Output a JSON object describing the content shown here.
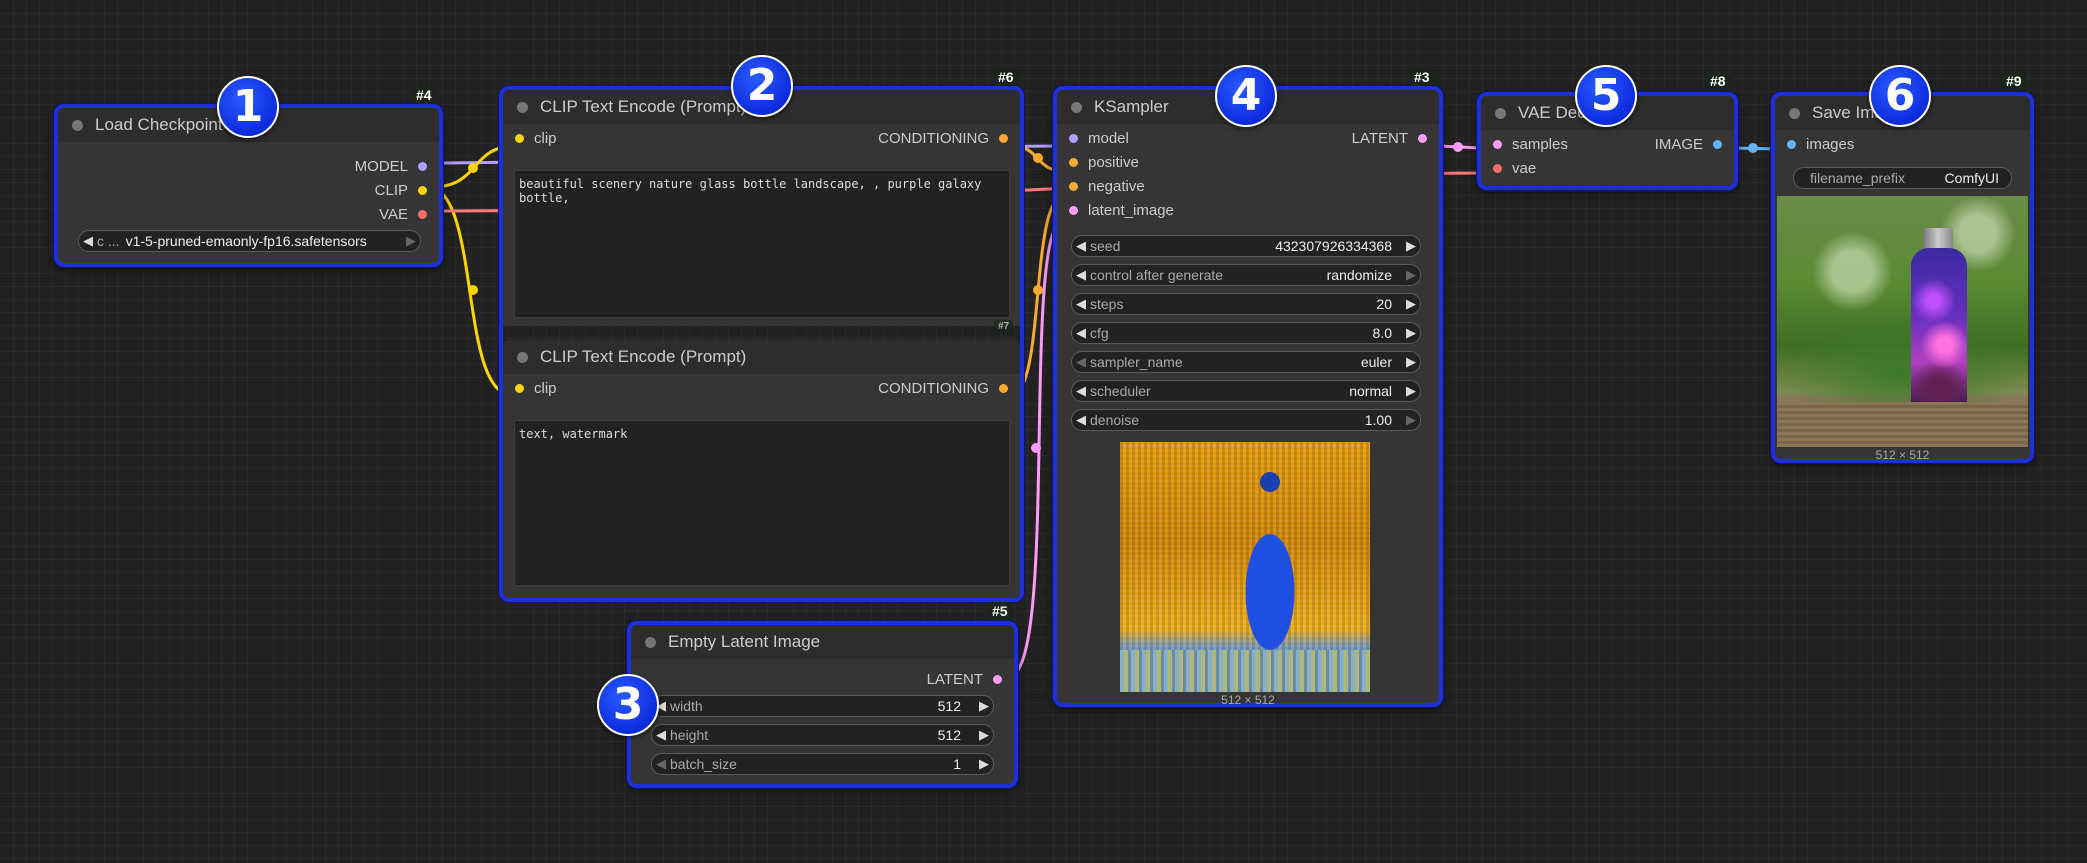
{
  "colors": {
    "node_border": "#1f2fd6",
    "model": "#b39dff",
    "clip": "#ffd500",
    "vae": "#ff6e6e",
    "conditioning": "#ffa931",
    "latent": "#ff9cf9",
    "image": "#64b5f6"
  },
  "nodes": {
    "load_checkpoint": {
      "title": "Load Checkpoint",
      "id": "#4",
      "outputs": [
        "MODEL",
        "CLIP",
        "VAE"
      ],
      "ckpt_prefix": "c ...",
      "ckpt_name": "v1-5-pruned-emaonly-fp16.safetensors"
    },
    "clip_pos": {
      "title": "CLIP Text Encode (Prompt)",
      "id": "#6",
      "input": "clip",
      "output": "CONDITIONING",
      "text": "beautiful scenery nature glass bottle landscape, , purple galaxy bottle,"
    },
    "clip_neg": {
      "title": "CLIP Text Encode (Prompt)",
      "id": "#7",
      "input": "clip",
      "output": "CONDITIONING",
      "text": "text, watermark"
    },
    "empty_latent": {
      "title": "Empty Latent Image",
      "id": "#5",
      "output": "LATENT",
      "widgets": [
        {
          "label": "width",
          "value": "512"
        },
        {
          "label": "height",
          "value": "512"
        },
        {
          "label": "batch_size",
          "value": "1"
        }
      ]
    },
    "ksampler": {
      "title": "KSampler",
      "id": "#3",
      "inputs": [
        "model",
        "positive",
        "negative",
        "latent_image"
      ],
      "output": "LATENT",
      "widgets": [
        {
          "label": "seed",
          "value": "432307926334368"
        },
        {
          "label": "control after generate",
          "value": "randomize"
        },
        {
          "label": "steps",
          "value": "20"
        },
        {
          "label": "cfg",
          "value": "8.0"
        },
        {
          "label": "sampler_name",
          "value": "euler"
        },
        {
          "label": "scheduler",
          "value": "normal"
        },
        {
          "label": "denoise",
          "value": "1.00"
        }
      ],
      "preview_size": "512 × 512"
    },
    "vae_decode": {
      "title": "VAE Decode",
      "id": "#8",
      "inputs": [
        "samples",
        "vae"
      ],
      "output": "IMAGE"
    },
    "save_image": {
      "title": "Save Image",
      "id": "#9",
      "input": "images",
      "prefix_label": "filename_prefix",
      "prefix_value": "ComfyUI",
      "image_size": "512 × 512"
    }
  },
  "badges": [
    "1",
    "2",
    "3",
    "4",
    "5",
    "6"
  ]
}
